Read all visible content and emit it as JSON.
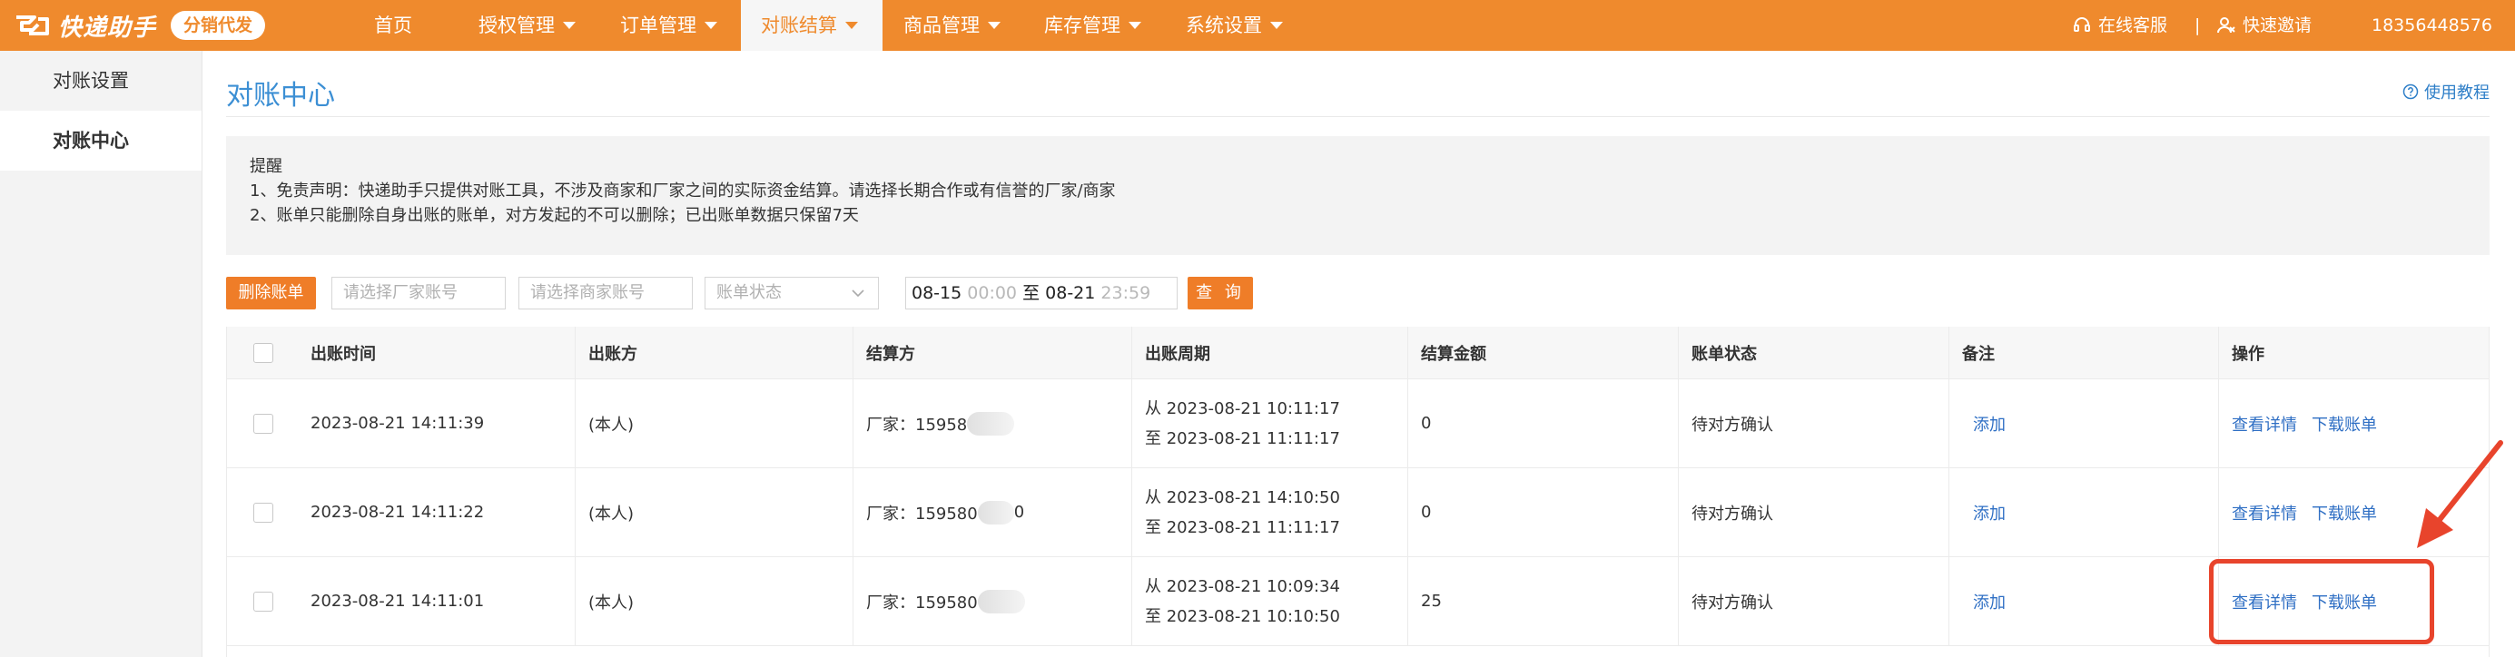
{
  "app": {
    "logo_text": "快递助手",
    "badge": "分销代发"
  },
  "nav": {
    "items": [
      {
        "label": "首页",
        "dropdown": false
      },
      {
        "label": "授权管理",
        "dropdown": true
      },
      {
        "label": "订单管理",
        "dropdown": true
      },
      {
        "label": "对账结算",
        "dropdown": true,
        "active": true
      },
      {
        "label": "商品管理",
        "dropdown": true
      },
      {
        "label": "库存管理",
        "dropdown": true
      },
      {
        "label": "系统设置",
        "dropdown": true
      }
    ],
    "online_service": "在线客服",
    "separator": "|",
    "quick_invite": "快速邀请",
    "account": "18356448576"
  },
  "sidebar": {
    "items": [
      {
        "label": "对账设置",
        "active": false
      },
      {
        "label": "对账中心",
        "active": true
      }
    ]
  },
  "main": {
    "title": "对账中心",
    "help_link": "使用教程",
    "notice": {
      "heading": "提醒",
      "line1": "1、免责声明：快递助手只提供对账工具，不涉及商家和厂家之间的实际资金结算。请选择长期合作或有信誉的厂家/商家",
      "line2": "2、账单只能删除自身出账的账单，对方发起的不可以删除；已出账单数据只保留7天"
    },
    "toolbar": {
      "delete_button": "删除账单",
      "factory_placeholder": "请选择厂家账号",
      "merchant_placeholder": "请选择商家账号",
      "status_placeholder": "账单状态",
      "date_from": "08-15",
      "time_from": "00:00",
      "date_to_sep": "至",
      "date_to": "08-21",
      "time_to": "23:59",
      "query_button": "查 询"
    },
    "table": {
      "headers": [
        "出账时间",
        "出账方",
        "结算方",
        "出账周期",
        "结算金额",
        "账单状态",
        "备注",
        "操作"
      ],
      "rows": [
        {
          "time": "2023-08-21 14:11:39",
          "issuer": "(本人)",
          "settler": "厂家：15958",
          "period_from": "从 2023-08-21 10:11:17",
          "period_to": "至 2023-08-21 11:11:17",
          "amount": "0",
          "status": "待对方确认",
          "remark": "添加",
          "view": "查看详情",
          "download": "下载账单"
        },
        {
          "time": "2023-08-21 14:11:22",
          "issuer": "(本人)",
          "settler": "厂家：159580",
          "settler_tail": "0",
          "period_from": "从 2023-08-21 14:10:50",
          "period_to": "至 2023-08-21 11:11:17",
          "amount": "0",
          "status": "待对方确认",
          "remark": "添加",
          "view": "查看详情",
          "download": "下载账单"
        },
        {
          "time": "2023-08-21 14:11:01",
          "issuer": "(本人)",
          "settler": "厂家：159580",
          "period_from": "从 2023-08-21 10:09:34",
          "period_to": "至 2023-08-21 10:10:50",
          "amount": "25",
          "status": "待对方确认",
          "remark": "添加",
          "view": "查看详情",
          "download": "下载账单"
        }
      ]
    }
  },
  "colors": {
    "brand_orange": "#ef8a2d",
    "button_orange": "#ef7d28",
    "link_blue": "#2f6fc4",
    "title_blue": "#3c8fd4",
    "annotation_red": "#e8442c"
  }
}
